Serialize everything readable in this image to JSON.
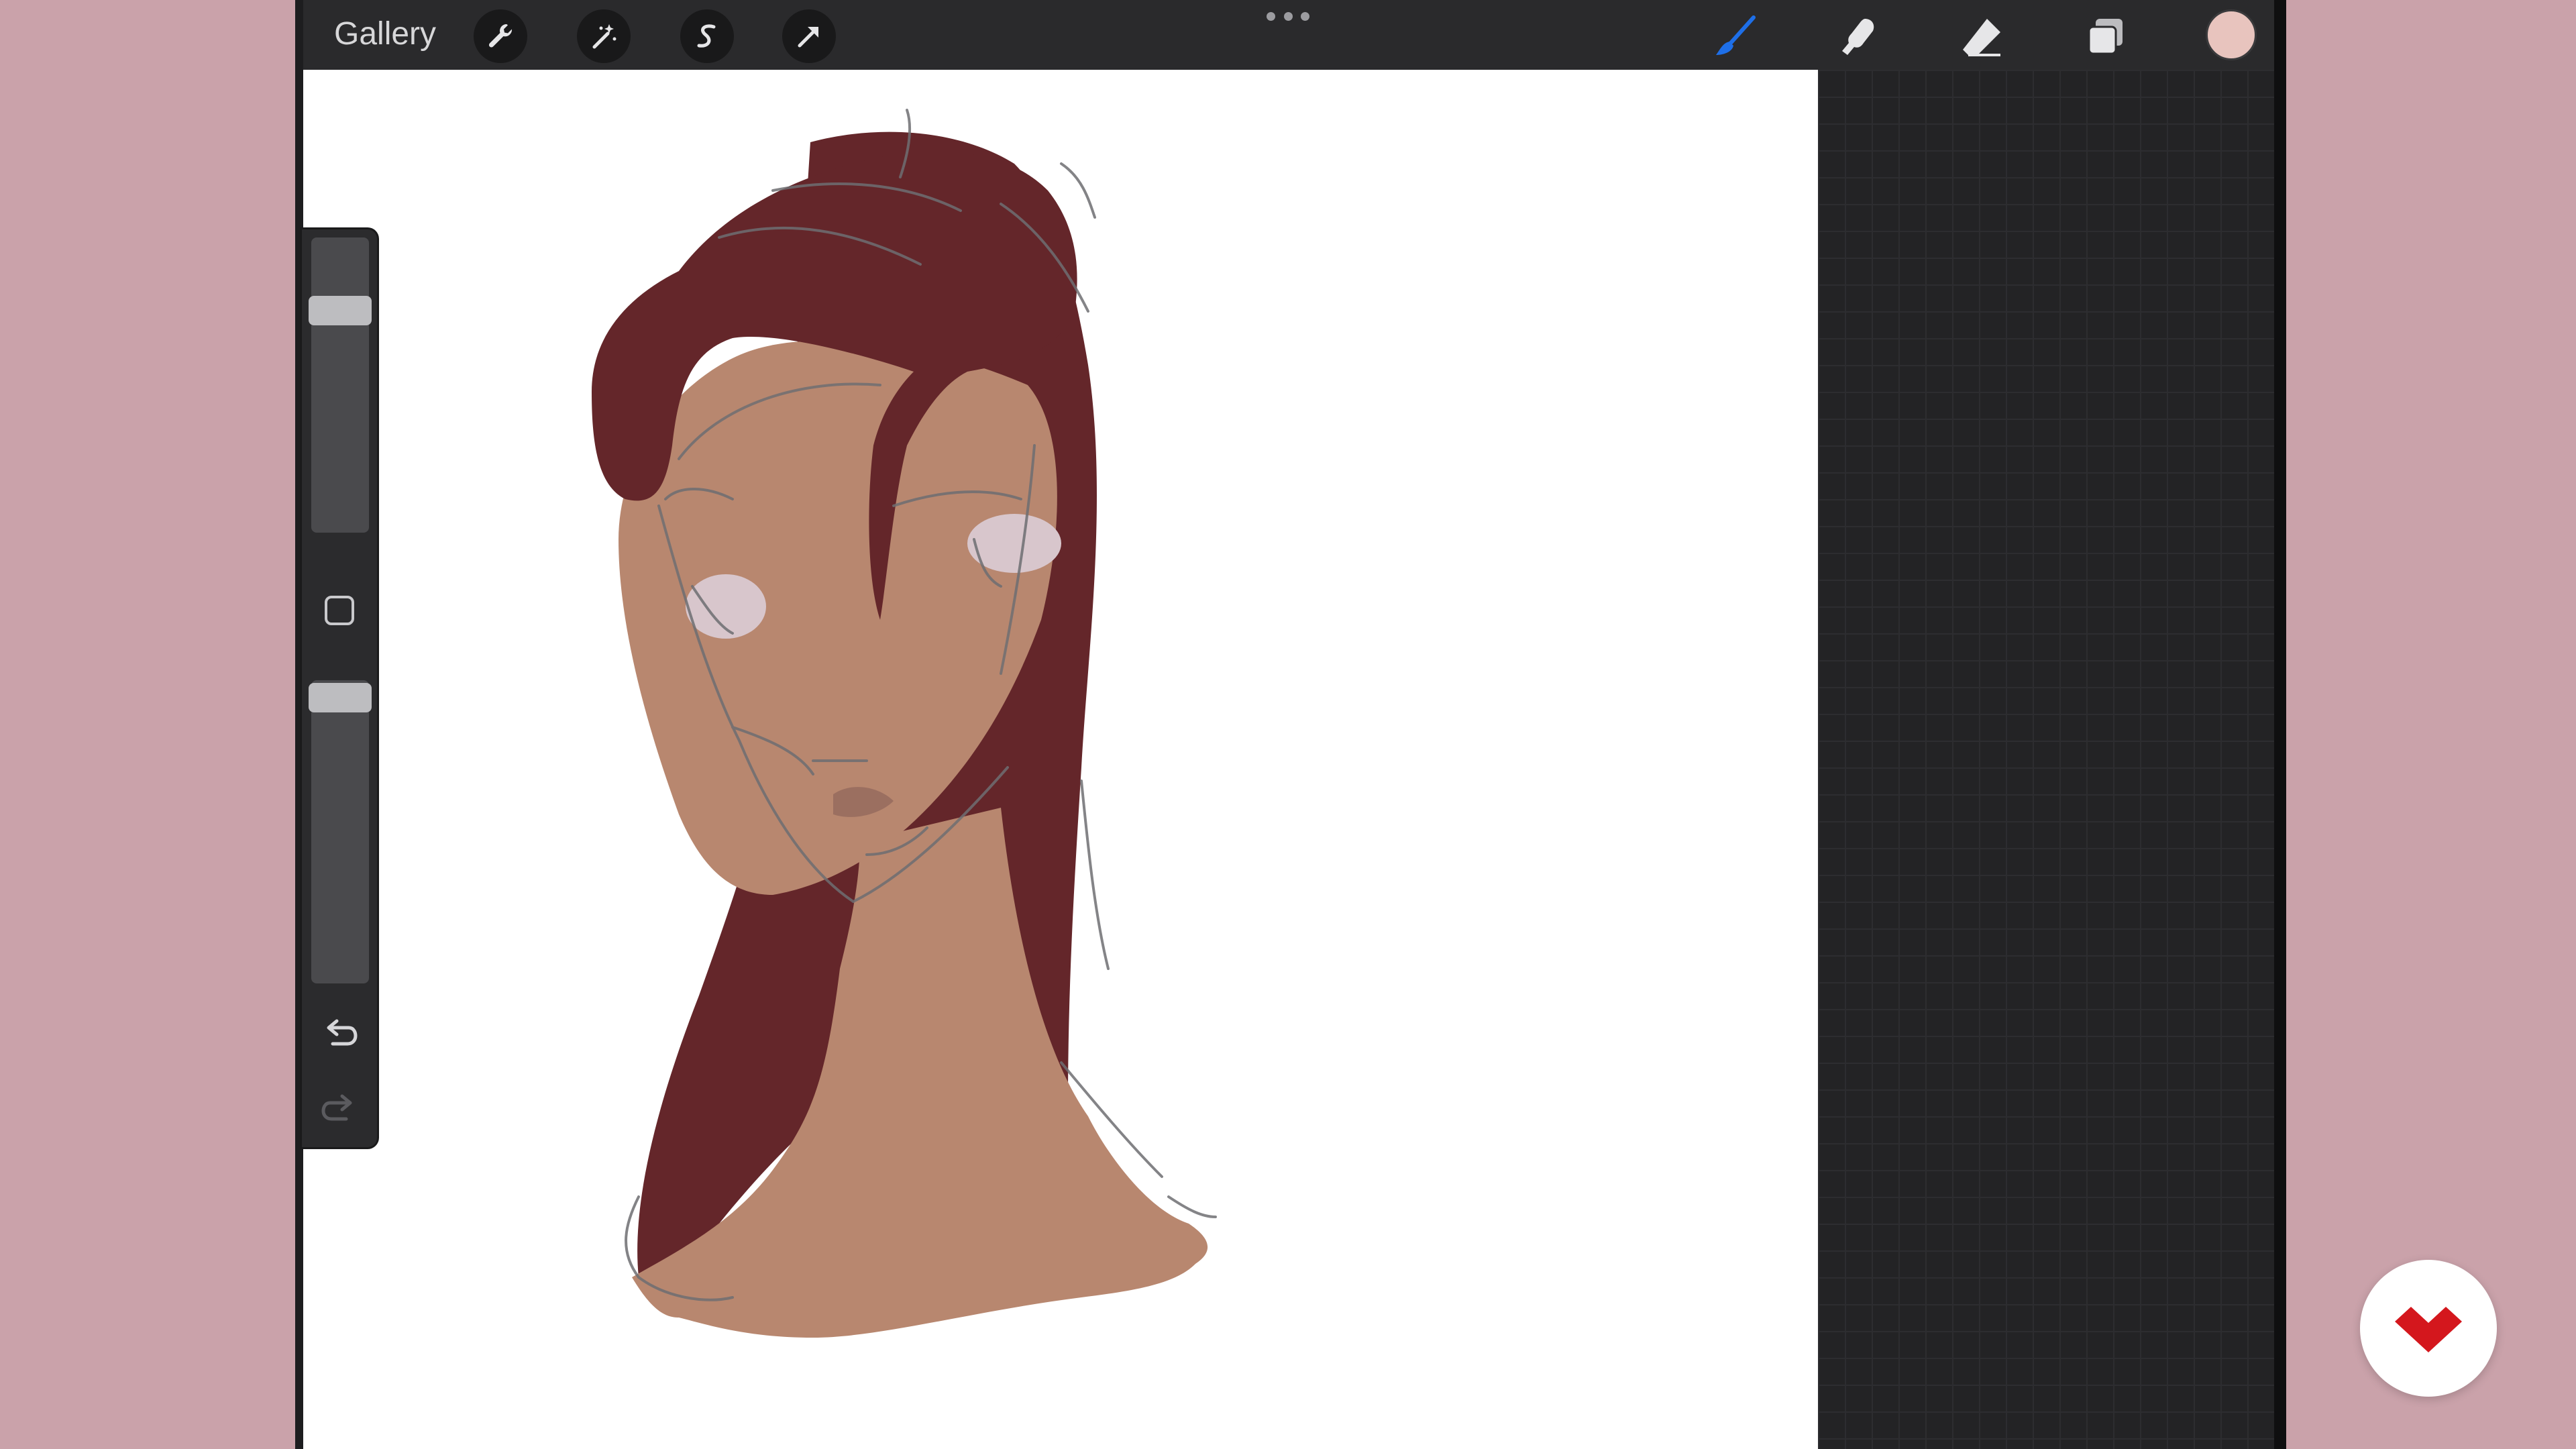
{
  "toolbar": {
    "gallery_label": "Gallery",
    "left_tools": [
      {
        "name": "actions",
        "icon": "wrench-icon"
      },
      {
        "name": "adjustments",
        "icon": "magic-wand-icon"
      },
      {
        "name": "selection",
        "icon": "selection-s-icon"
      },
      {
        "name": "transform",
        "icon": "arrow-cursor-icon"
      }
    ],
    "more_icon": "ellipsis-icon",
    "right_tools": [
      {
        "name": "brush",
        "icon": "brush-icon",
        "active": true
      },
      {
        "name": "smudge",
        "icon": "smudge-icon",
        "active": false
      },
      {
        "name": "eraser",
        "icon": "eraser-icon",
        "active": false
      },
      {
        "name": "layers",
        "icon": "layers-icon",
        "active": false
      }
    ],
    "current_color": "#e8c4be",
    "active_color": "#1e6fe8"
  },
  "sidebar": {
    "brush_size_level": 0.78,
    "opacity_level": 1.0,
    "undo_icon": "undo-icon",
    "redo_icon": "redo-icon"
  },
  "artwork": {
    "hair_color": "#64262a",
    "skin_color": "#b8876f",
    "eye_color": "#d8c6cc",
    "sketch_color": "#6e6e72"
  },
  "badge": {
    "icon": "brand-logo-icon",
    "color": "#d4171d"
  }
}
